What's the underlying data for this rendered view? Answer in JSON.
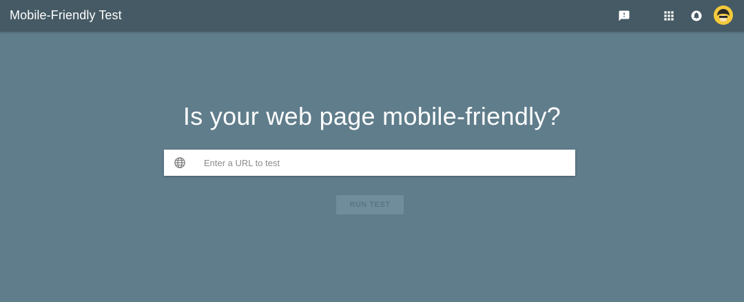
{
  "header": {
    "title": "Mobile-Friendly Test",
    "icons": {
      "feedback": "feedback-icon",
      "apps": "apps-grid-icon",
      "notifications": "notifications-icon",
      "avatar": "account-avatar"
    }
  },
  "main": {
    "headline": "Is your web page mobile-friendly?",
    "url_input": {
      "placeholder": "Enter a URL to test",
      "value": "",
      "icon": "globe-icon"
    },
    "run_button": {
      "label": "RUN TEST",
      "enabled": false
    }
  },
  "colors": {
    "header_bg": "#455a64",
    "page_bg": "#607d8b",
    "avatar_bg": "#f3c93b"
  }
}
